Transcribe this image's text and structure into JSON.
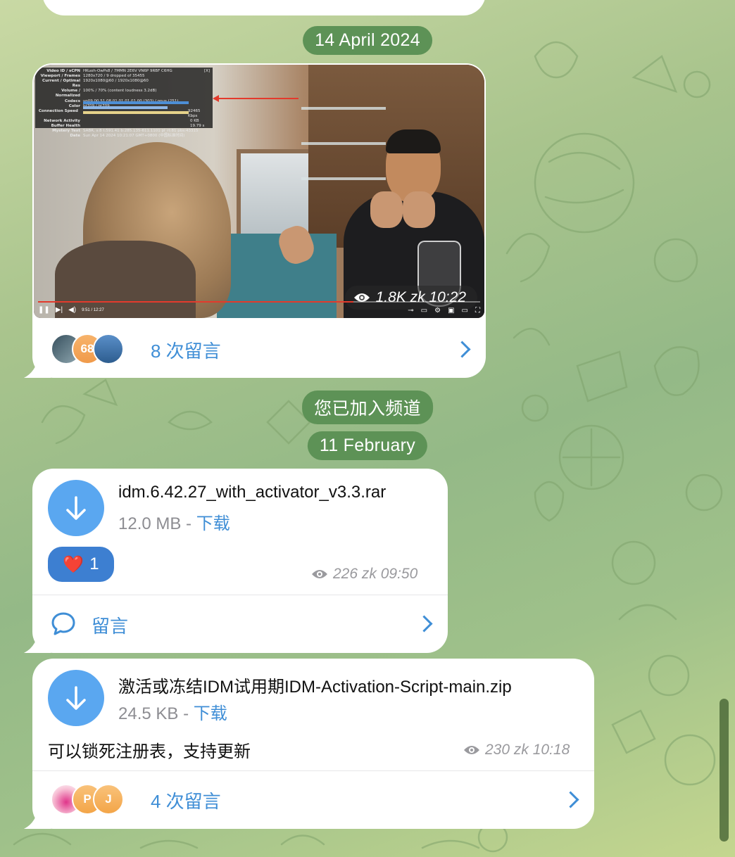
{
  "colors": {
    "accent": "#3f8ed6",
    "date_pill": "#5d9256",
    "reaction": "#3d7fd1",
    "download": "#5aa7f0"
  },
  "dates": {
    "first": "14 April 2024",
    "joined": "您已加入频道",
    "second": "11 February"
  },
  "video_post": {
    "stats_overlay": {
      "rows": [
        {
          "k": "Video ID / sCPN",
          "v": "HKuoh-OwPs8  /  7MMN 2E6V VN6P 9RBF C6HG"
        },
        {
          "k": "Viewport / Frames",
          "v": "1280x720 / 9 dropped of 35455"
        },
        {
          "k": "Current / Optimal Res",
          "v": "1920x1080@60 / 1920x1080@60"
        },
        {
          "k": "Volume / Normalized",
          "v": "100% / 70% (content loudness 3.2dB)"
        },
        {
          "k": "Codecs",
          "v": "vp09.00.51.08.01.01.01.01.00 (303) / opus (251)"
        },
        {
          "k": "Color",
          "v": "bt709 / bt709"
        },
        {
          "k": "Connection Speed",
          "v": "92465 Kbps"
        },
        {
          "k": "Network Activity",
          "v": "0 KB"
        },
        {
          "k": "Buffer Health",
          "v": "19.79 s"
        },
        {
          "k": "Mystery Text",
          "v": "SABR, s:8 t:591.41 b:285.135-611.1101 pl_rt:81 pbs:43315"
        },
        {
          "k": "Date",
          "v": "Sun Apr 14 2024 10:21:07 GMT+0800 (中国标准时间)"
        }
      ],
      "close": "[X]"
    },
    "time": "9:51 / 12:27",
    "views_badge": "1.8K zk 10:22",
    "comment_avatars": [
      "",
      "68",
      ""
    ],
    "comments_label": "8 次留言"
  },
  "file1": {
    "name": "idm.6.42.27_with_activator_v3.3.rar",
    "size": "12.0 MB",
    "dash": " - ",
    "action": "下载",
    "reaction_emoji": "❤️",
    "reaction_count": "1",
    "views": "226 zk 09:50",
    "comment_label": "留言"
  },
  "file2": {
    "name": "激活或冻结IDM试用期IDM-Activation-Script-main.zip",
    "size": "24.5 KB",
    "dash": " - ",
    "action": "下载",
    "caption": "可以锁死注册表，支持更新",
    "views": "230 zk 10:18",
    "comment_avatars": [
      "",
      "P",
      "J"
    ],
    "comments_label": "4 次留言"
  }
}
